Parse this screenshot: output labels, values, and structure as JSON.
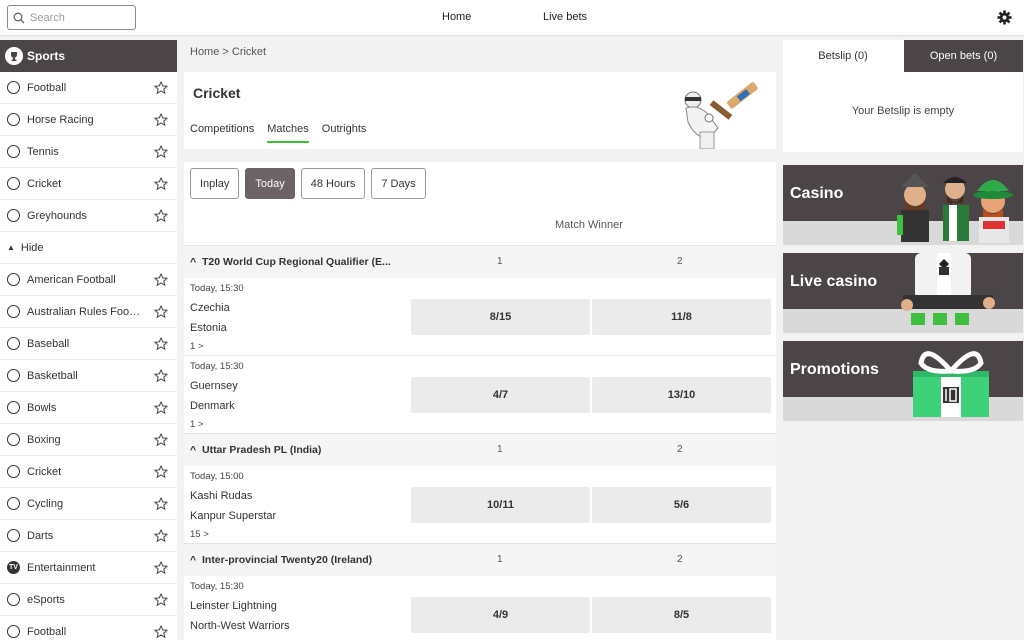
{
  "header": {
    "search_placeholder": "Search",
    "nav": [
      "Home",
      "Live bets"
    ]
  },
  "sidebar": {
    "title": "Sports",
    "top_items": [
      {
        "label": "Football",
        "icon": "football-icon"
      },
      {
        "label": "Horse Racing",
        "icon": "horse-racing-icon"
      },
      {
        "label": "Tennis",
        "icon": "tennis-icon"
      },
      {
        "label": "Cricket",
        "icon": "cricket-icon"
      },
      {
        "label": "Greyhounds",
        "icon": "greyhounds-icon"
      }
    ],
    "hide_label": "Hide",
    "items": [
      {
        "label": "American Football",
        "icon": "american-football-icon"
      },
      {
        "label": "Australian Rules Football",
        "icon": "australian-rules-icon"
      },
      {
        "label": "Baseball",
        "icon": "baseball-icon"
      },
      {
        "label": "Basketball",
        "icon": "basketball-icon"
      },
      {
        "label": "Bowls",
        "icon": "bowls-icon"
      },
      {
        "label": "Boxing",
        "icon": "boxing-icon"
      },
      {
        "label": "Cricket",
        "icon": "cricket-icon"
      },
      {
        "label": "Cycling",
        "icon": "cycling-icon"
      },
      {
        "label": "Darts",
        "icon": "darts-icon"
      },
      {
        "label": "Entertainment",
        "icon": "tv-icon"
      },
      {
        "label": "eSports",
        "icon": "esports-icon"
      },
      {
        "label": "Football",
        "icon": "football-icon"
      }
    ]
  },
  "main": {
    "breadcrumb": "Home > Cricket",
    "title": "Cricket",
    "tabs": [
      "Competitions",
      "Matches",
      "Outrights"
    ],
    "active_tab": "Matches",
    "filters": [
      "Inplay",
      "Today",
      "48 Hours",
      "7 Days"
    ],
    "active_filter": "Today",
    "market_label": "Match Winner",
    "competitions": [
      {
        "name": "T20 World Cup Regional Qualifier (E...",
        "col1": "1",
        "col2": "2",
        "events": [
          {
            "time": "Today, 15:30",
            "team1": "Czechia",
            "team2": "Estonia",
            "more": "1 >",
            "odd1": "8/15",
            "odd2": "11/8"
          },
          {
            "time": "Today, 15:30",
            "team1": "Guernsey",
            "team2": "Denmark",
            "more": "1 >",
            "odd1": "4/7",
            "odd2": "13/10"
          }
        ]
      },
      {
        "name": "Uttar Pradesh PL (India)",
        "col1": "1",
        "col2": "2",
        "events": [
          {
            "time": "Today, 15:00",
            "team1": "Kashi Rudas",
            "team2": "Kanpur Superstar",
            "more": "15 >",
            "odd1": "10/11",
            "odd2": "5/6"
          }
        ]
      },
      {
        "name": "Inter-provincial Twenty20 (Ireland)",
        "col1": "1",
        "col2": "2",
        "events": [
          {
            "time": "Today, 15:30",
            "team1": "Leinster Lightning",
            "team2": "North-West Warriors",
            "more": "",
            "odd1": "4/9",
            "odd2": "8/5"
          }
        ]
      }
    ]
  },
  "betslip": {
    "tab1": "Betslip (0)",
    "tab2": "Open bets (0)",
    "empty_text": "Your Betslip is empty"
  },
  "promos": [
    {
      "label": "Casino"
    },
    {
      "label": "Live casino"
    },
    {
      "label": "Promotions"
    }
  ],
  "colors": {
    "dark": "#4b4548",
    "accent_green": "#3fbf3f",
    "active_filter": "#6b6366"
  }
}
